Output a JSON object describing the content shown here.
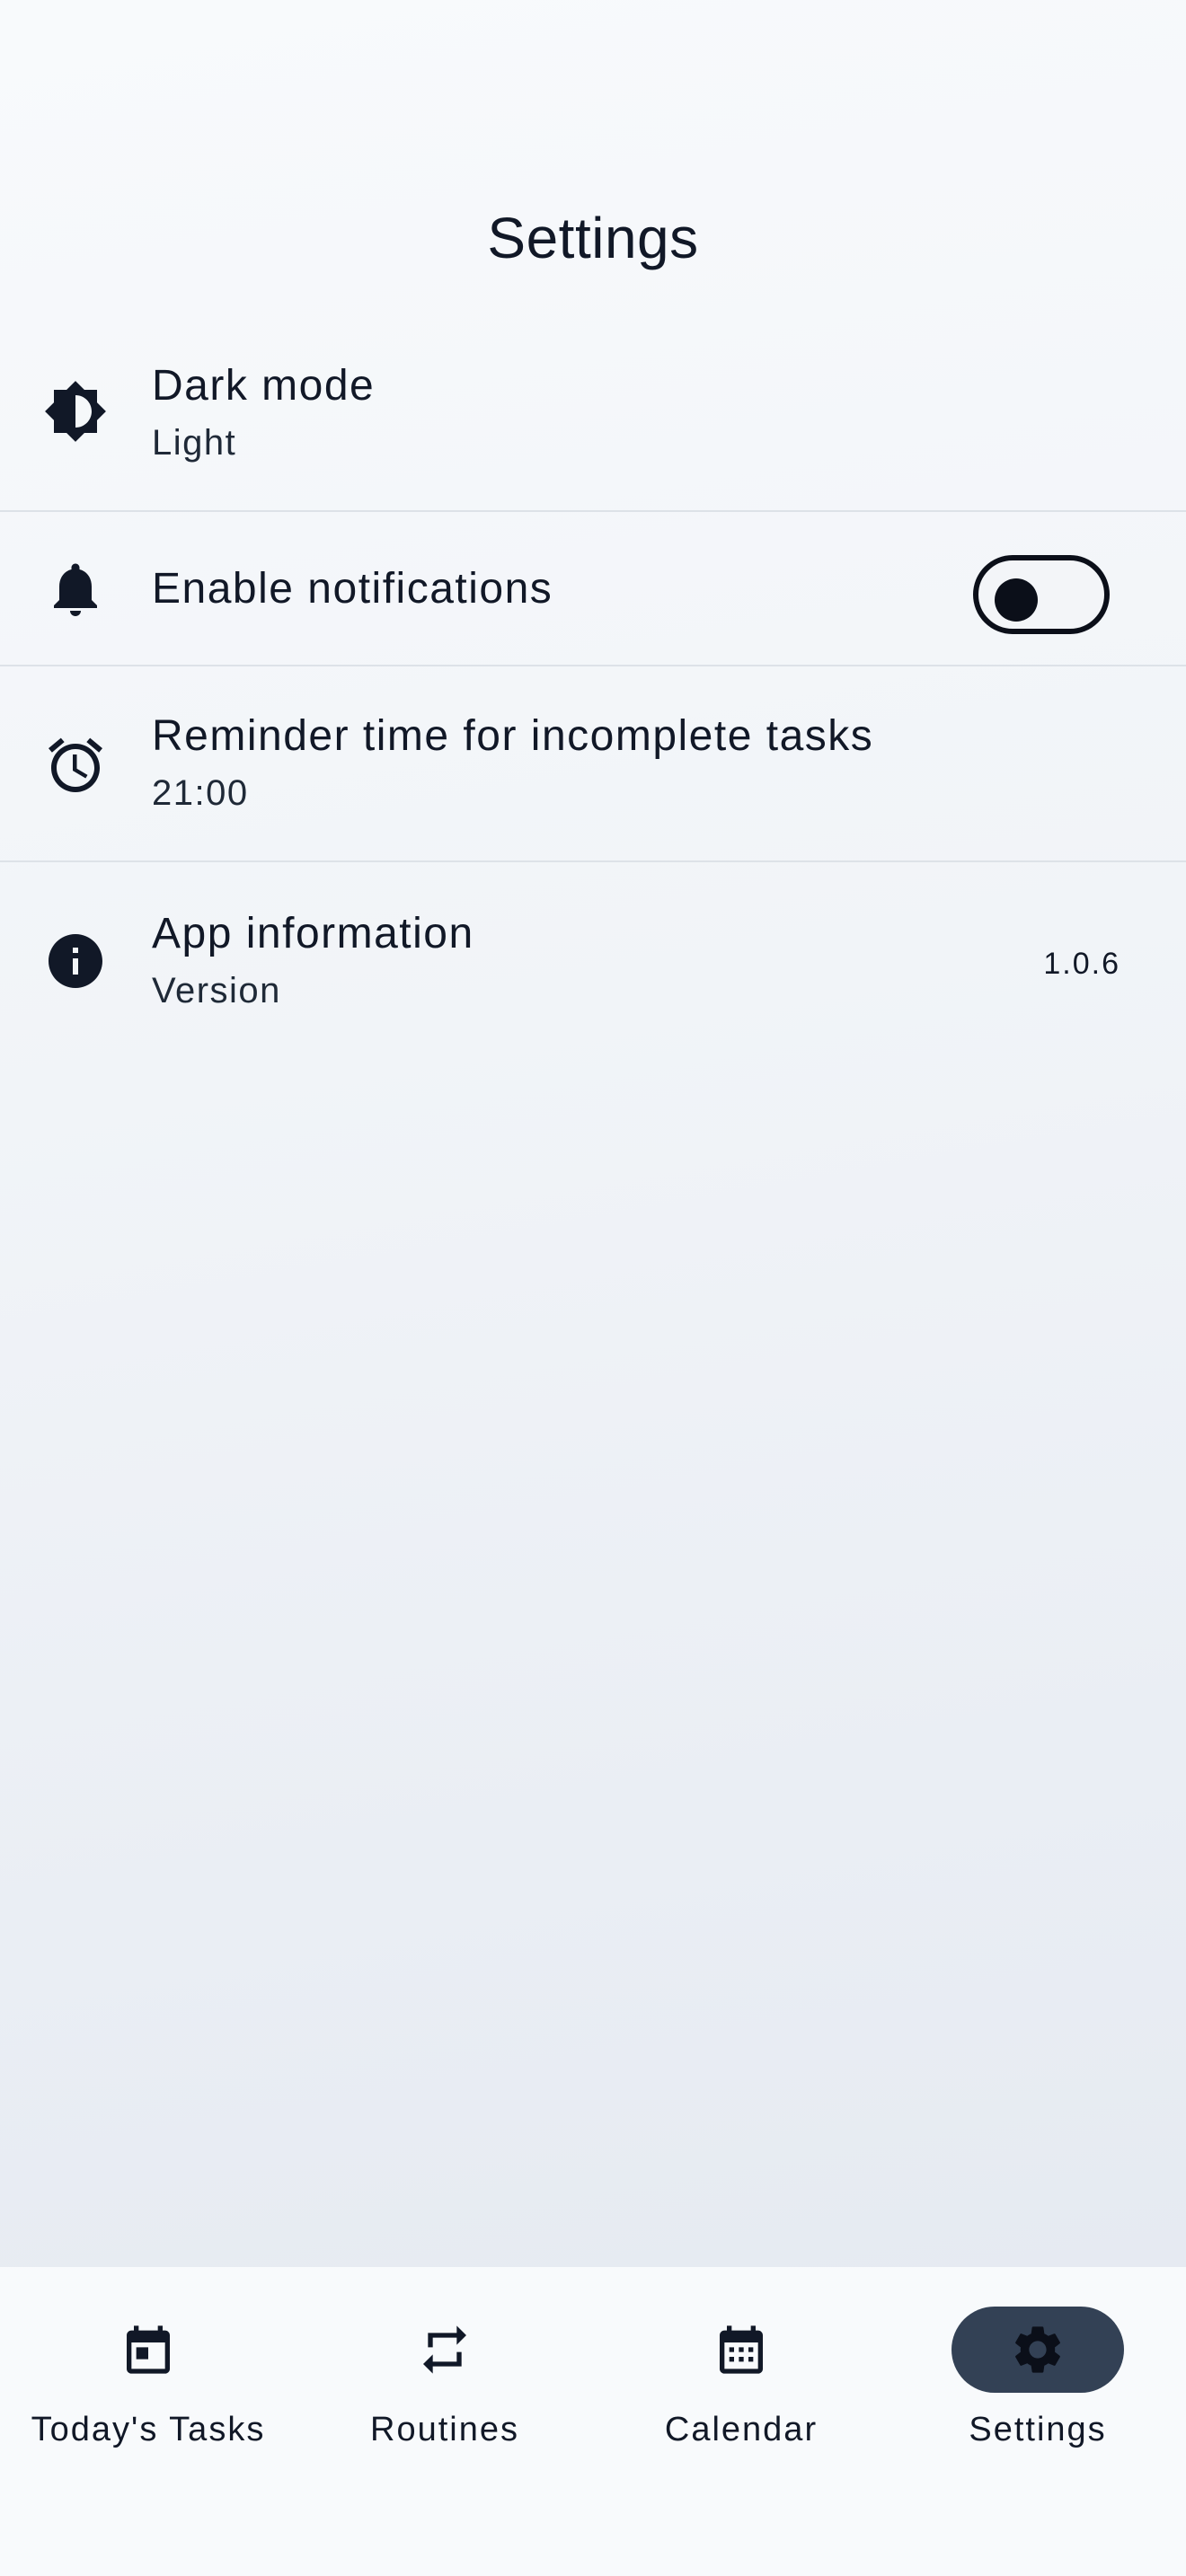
{
  "header": {
    "title": "Settings"
  },
  "settings": {
    "dark_mode": {
      "label": "Dark mode",
      "value": "Light",
      "icon": "brightness-icon"
    },
    "notifications": {
      "label": "Enable notifications",
      "enabled": false,
      "icon": "bell-icon"
    },
    "reminder": {
      "label": "Reminder time for incomplete tasks",
      "value": "21:00",
      "icon": "alarm-icon"
    },
    "app_info": {
      "label": "App information",
      "sublabel": "Version",
      "version": "1.0.6",
      "icon": "info-icon"
    }
  },
  "bottom_nav": {
    "items": [
      {
        "label": "Today's Tasks",
        "icon": "calendar-today-icon",
        "active": false
      },
      {
        "label": "Routines",
        "icon": "repeat-icon",
        "active": false
      },
      {
        "label": "Calendar",
        "icon": "calendar-month-icon",
        "active": false
      },
      {
        "label": "Settings",
        "icon": "gear-icon",
        "active": true
      }
    ]
  },
  "colors": {
    "text": "#111827",
    "active_pill": "#334155",
    "divider": "#dde2e8",
    "nav_background": "#f8fafc"
  }
}
